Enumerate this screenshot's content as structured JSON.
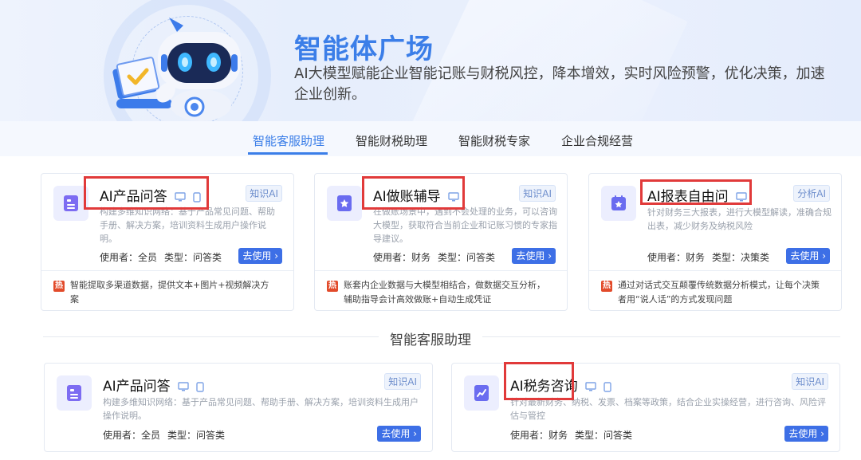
{
  "banner": {
    "title": "智能体广场",
    "description": "AI大模型赋能企业智能记账与财税风控，降本增效，实时风险预警，优化决策，加速企业创新。"
  },
  "tabs": [
    {
      "label": "智能客服助理",
      "active": true
    },
    {
      "label": "智能财税助理",
      "active": false
    },
    {
      "label": "智能财税专家",
      "active": false
    },
    {
      "label": "企业合规经营",
      "active": false
    }
  ],
  "featured_cards": [
    {
      "title": "AI产品问答",
      "tag": "知识AI",
      "description": "构建多维知识网络：基于产品常见问题、帮助手册、解决方案，培训资料生成用户操作说明。",
      "user": "使用者：全员",
      "type": "类型：问答类",
      "button": "去使用",
      "hot_badge": "热",
      "hot_text": "智能提取多渠道数据，提供文本+图片+视频解决方案",
      "icon": "document-list-icon"
    },
    {
      "title": "AI做账辅导",
      "tag": "知识AI",
      "description": "在做账场景中，遇到不会处理的业务，可以咨询大模型，获取符合当前企业和记账习惯的专家指导建议。",
      "user": "使用者：财务",
      "type": "类型：问答类",
      "button": "去使用",
      "hot_badge": "热",
      "hot_text": "账套内企业数据与大模型相结合，做数据交互分析，辅助指导会计高效做账+自动生成凭证",
      "icon": "star-bookmark-icon"
    },
    {
      "title": "AI报表自由问",
      "tag": "分析AI",
      "description": "针对财务三大报表，进行大模型解读，准确合规出表，减少财务及纳税风险",
      "user": "使用者：财务",
      "type": "类型：决策类",
      "button": "去使用",
      "hot_badge": "热",
      "hot_text": "通过对话式交互颠覆传统数据分析模式，让每个决策者用“说人话”的方式发现问题",
      "icon": "calendar-star-icon"
    }
  ],
  "section": {
    "title": "智能客服助理"
  },
  "section_cards": [
    {
      "title": "AI产品问答",
      "tag": "知识AI",
      "description": "构建多维知识网络：基于产品常见问题、帮助手册、解决方案，培训资料生成用户操作说明。",
      "user": "使用者：全员",
      "type": "类型：问答类",
      "button": "去使用",
      "icon": "document-list-icon"
    },
    {
      "title": "AI税务咨询",
      "tag": "知识AI",
      "description": "针对最新财务、纳税、发票、档案等政策，结合企业实操经营，进行咨询、风险评估与管控",
      "user": "使用者：财务",
      "type": "类型：问答类",
      "button": "去使用",
      "icon": "chart-edit-icon"
    }
  ],
  "colors": {
    "accent": "#3b7ee8",
    "button": "#3d6fe6",
    "highlight_box": "#e13a3a",
    "hot_badge": "#e24b2b"
  }
}
